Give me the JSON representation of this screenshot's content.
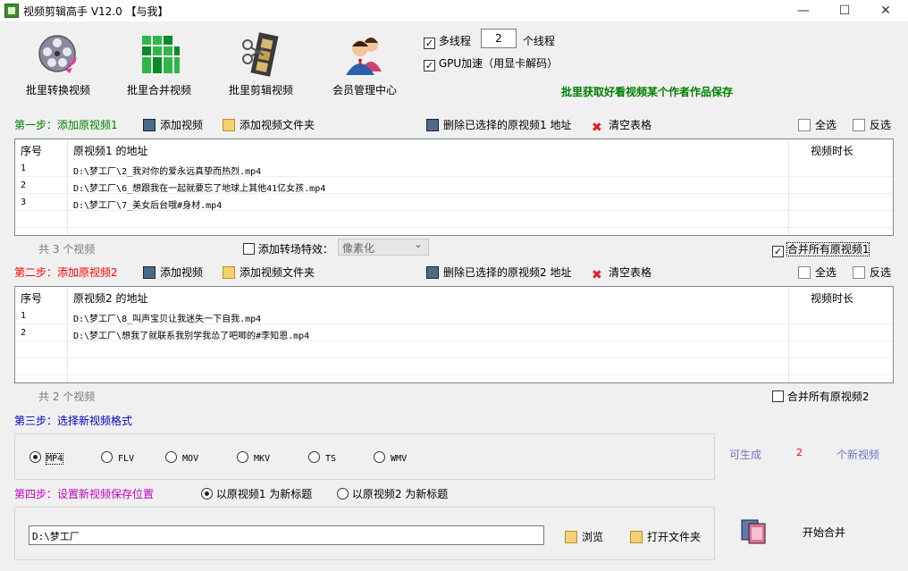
{
  "window": {
    "title": "视频剪辑高手 V12.0  【与我】",
    "min_glyph": "—",
    "max_glyph": "☐",
    "close_glyph": "✕"
  },
  "toolbar": {
    "batch_convert": "批里转换视频",
    "batch_merge": "批里合并视频",
    "batch_edit": "批里剪辑视频",
    "member_center": "会员管理中心"
  },
  "options": {
    "multithread_label": "多线程",
    "multithread_checked": "✓",
    "thread_count": "2",
    "thread_unit": "个线程",
    "gpu_label": "GPU加速（用显卡解码）",
    "gpu_checked": "✓",
    "promo": "批里获取好看视频某个作者作品保存"
  },
  "step1": {
    "label": "第一步：添加原视频1",
    "add_video": "添加视频",
    "add_folder": "添加视频文件夹",
    "delete_selected": "删除已选择的原视频1 地址",
    "clear_table": "清空表格",
    "select_all": "全选",
    "invert": "反选",
    "columns": {
      "index": "序号",
      "address": "原视频1 的地址",
      "duration": "视频时长"
    },
    "rows": [
      {
        "index": "1",
        "path": "D:\\梦工厂\\2_我对你的爱永远真挚而热烈.mp4",
        "duration": ""
      },
      {
        "index": "2",
        "path": "D:\\梦工厂\\6_想跟我在一起就要忘了地球上其他41亿女孩.mp4",
        "duration": ""
      },
      {
        "index": "3",
        "path": "D:\\梦工厂\\7_美女后台哦#身材.mp4",
        "duration": ""
      }
    ],
    "count_text": "共 3 个视频",
    "transition_label": "添加转场特效：",
    "transition_value": "像素化",
    "merge_all": "合并所有原视频1",
    "merge_all_checked": "✓"
  },
  "step2": {
    "label": "第二步：添加原视频2",
    "add_video": "添加视频",
    "add_folder": "添加视频文件夹",
    "delete_selected": "删除已选择的原视频2 地址",
    "clear_table": "清空表格",
    "select_all": "全选",
    "invert": "反选",
    "columns": {
      "index": "序号",
      "address": "原视频2 的地址",
      "duration": "视频时长"
    },
    "rows": [
      {
        "index": "1",
        "path": "D:\\梦工厂\\8_叫声宝贝让我迷失一下自我.mp4",
        "duration": ""
      },
      {
        "index": "2",
        "path": "D:\\梦工厂\\想我了就联系我别学我怂了吧唧的#李知恩.mp4",
        "duration": ""
      }
    ],
    "count_text": "共 2 个视频",
    "merge_all": "合并所有原视频2"
  },
  "step3": {
    "label": "第三步：选择新视频格式",
    "formats": [
      "MP4",
      "FLV",
      "MOV",
      "MKV",
      "TS",
      "WMV"
    ],
    "selected_format": "MP4",
    "can_generate": "可生成",
    "count": "2",
    "new_videos": "个新视频"
  },
  "step4": {
    "label": "第四步：设置新视频保存位置",
    "title_opt1": "以原视频1 为新标题",
    "title_opt2": "以原视频2 为新标题",
    "path": "D:\\梦工厂",
    "browse": "浏览",
    "open_folder": "打开文件夹",
    "start": "开始合并"
  },
  "colors": {
    "step1": "#008000",
    "step2": "#ff0000",
    "step3": "#0000c0",
    "step4": "#c000c0",
    "promo": "#008000",
    "generate": "#7070c8",
    "count": "#ff0000"
  }
}
